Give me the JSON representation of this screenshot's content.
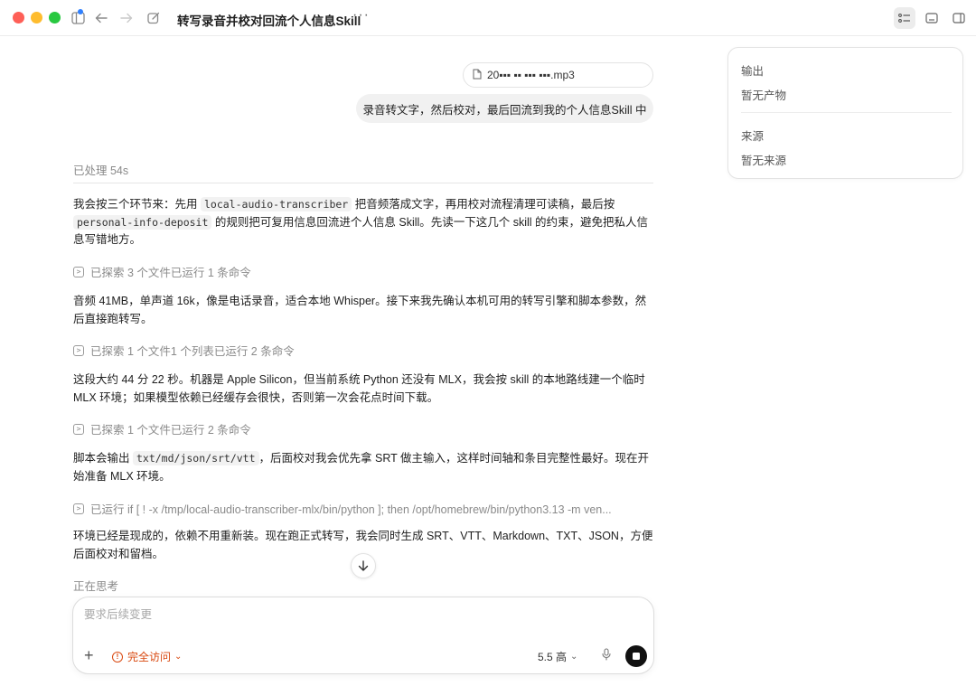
{
  "titlebar": {
    "title": "转写录音并校对回流个人信息Skill",
    "more": "···"
  },
  "conversation": {
    "file_name": "20▪▪▪ ▪▪ ▪▪▪ ▪▪▪.mp3",
    "user_message": "录音转文字，然后校对，最后回流到我的个人信息Skill 中",
    "processed": "已处理 54s",
    "p1": {
      "a": "我会按三个环节来：先用 ",
      "code1": "local-audio-transcriber",
      "b": " 把音频落成文字，再用校对流程清理可读稿，最后按 ",
      "code2": "personal-info-deposit",
      "c": " 的规则把可复用信息回流进个人信息 Skill。先读一下这几个 skill 的约束，避免把私人信息写错地方。"
    },
    "a1": "已探索 3 个文件已运行 1 条命令",
    "p2": "音频 41MB，单声道 16k，像是电话录音，适合本地 Whisper。接下来我先确认本机可用的转写引擎和脚本参数，然后直接跑转写。",
    "a2": "已探索 1 个文件1 个列表已运行 2 条命令",
    "p3": "这段大约 44 分 22 秒。机器是 Apple Silicon，但当前系统 Python 还没有 MLX，我会按 skill 的本地路线建一个临时 MLX 环境；如果模型依赖已经缓存会很快，否则第一次会花点时间下载。",
    "a3": "已探索 1 个文件已运行 2 条命令",
    "p4": {
      "a": "脚本会输出 ",
      "code1": "txt/md/json/srt/vtt",
      "b": "，后面校对我会优先拿 SRT 做主输入，这样时间轴和条目完整性最好。现在开始准备 MLX 环境。"
    },
    "a4": "已运行 if [ ! -x /tmp/local-audio-transcriber-mlx/bin/python ]; then /opt/homebrew/bin/python3.13 -m ven...",
    "p5": "环境已经是现成的，依赖不用重新装。现在跑正式转写，我会同时生成 SRT、VTT、Markdown、TXT、JSON，方便后面校对和留档。",
    "thinking": "正在思考"
  },
  "composer": {
    "placeholder": "要求后续变更",
    "plus": "+",
    "access_label": "完全访问",
    "model_label": "5.5 高"
  },
  "side_panel": {
    "output_heading": "输出",
    "output_value": "暂无产物",
    "source_heading": "来源",
    "source_value": "暂无来源"
  },
  "colors": {
    "accent_warning": "#d9480f",
    "close": "#fe5f57",
    "minimize": "#febc2e",
    "zoom": "#28c840"
  }
}
